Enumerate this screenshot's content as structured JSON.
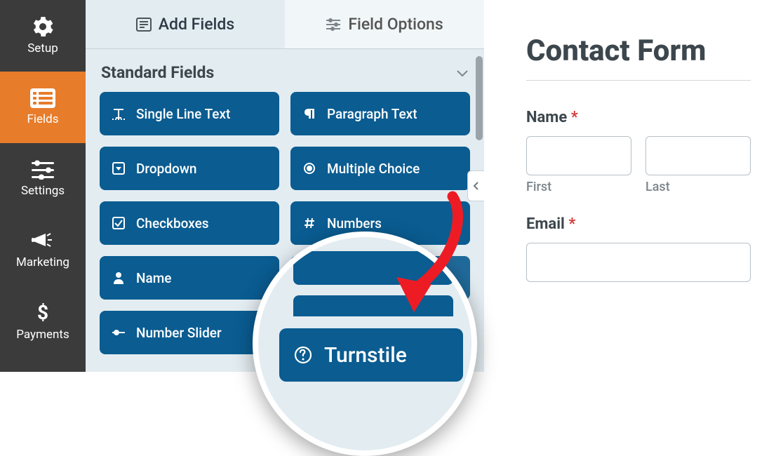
{
  "sidebar": {
    "items": [
      {
        "label": "Setup",
        "icon": "gear-icon",
        "active": false
      },
      {
        "label": "Fields",
        "icon": "list-icon",
        "active": true
      },
      {
        "label": "Settings",
        "icon": "sliders-icon",
        "active": false
      },
      {
        "label": "Marketing",
        "icon": "megaphone-icon",
        "active": false
      },
      {
        "label": "Payments",
        "icon": "dollar-icon",
        "active": false
      }
    ]
  },
  "panel": {
    "tabs": [
      {
        "label": "Add Fields",
        "icon": "form-icon",
        "active": true
      },
      {
        "label": "Field Options",
        "icon": "sliders-h-icon",
        "active": false
      }
    ],
    "section_title": "Standard Fields",
    "fields": [
      {
        "label": "Single Line Text",
        "icon": "text-icon"
      },
      {
        "label": "Paragraph Text",
        "icon": "paragraph-icon"
      },
      {
        "label": "Dropdown",
        "icon": "dropdown-icon"
      },
      {
        "label": "Multiple Choice",
        "icon": "radio-icon"
      },
      {
        "label": "Checkboxes",
        "icon": "checkbox-icon"
      },
      {
        "label": "Numbers",
        "icon": "hash-icon"
      },
      {
        "label": "Name",
        "icon": "person-icon"
      },
      {
        "label": "",
        "icon": ""
      },
      {
        "label": "Number Slider",
        "icon": "slider-icon"
      }
    ],
    "magnified_field": {
      "label": "Turnstile",
      "icon": "question-circle-icon"
    }
  },
  "preview": {
    "title": "Contact Form",
    "name_label": "Name",
    "first_label": "First",
    "last_label": "Last",
    "email_label": "Email",
    "required_marker": "*"
  },
  "colors": {
    "sidebar_bg": "#3b3b3b",
    "accent": "#e77c2b",
    "field_btn": "#0a5c91",
    "panel_bg": "#e3ecf1"
  }
}
